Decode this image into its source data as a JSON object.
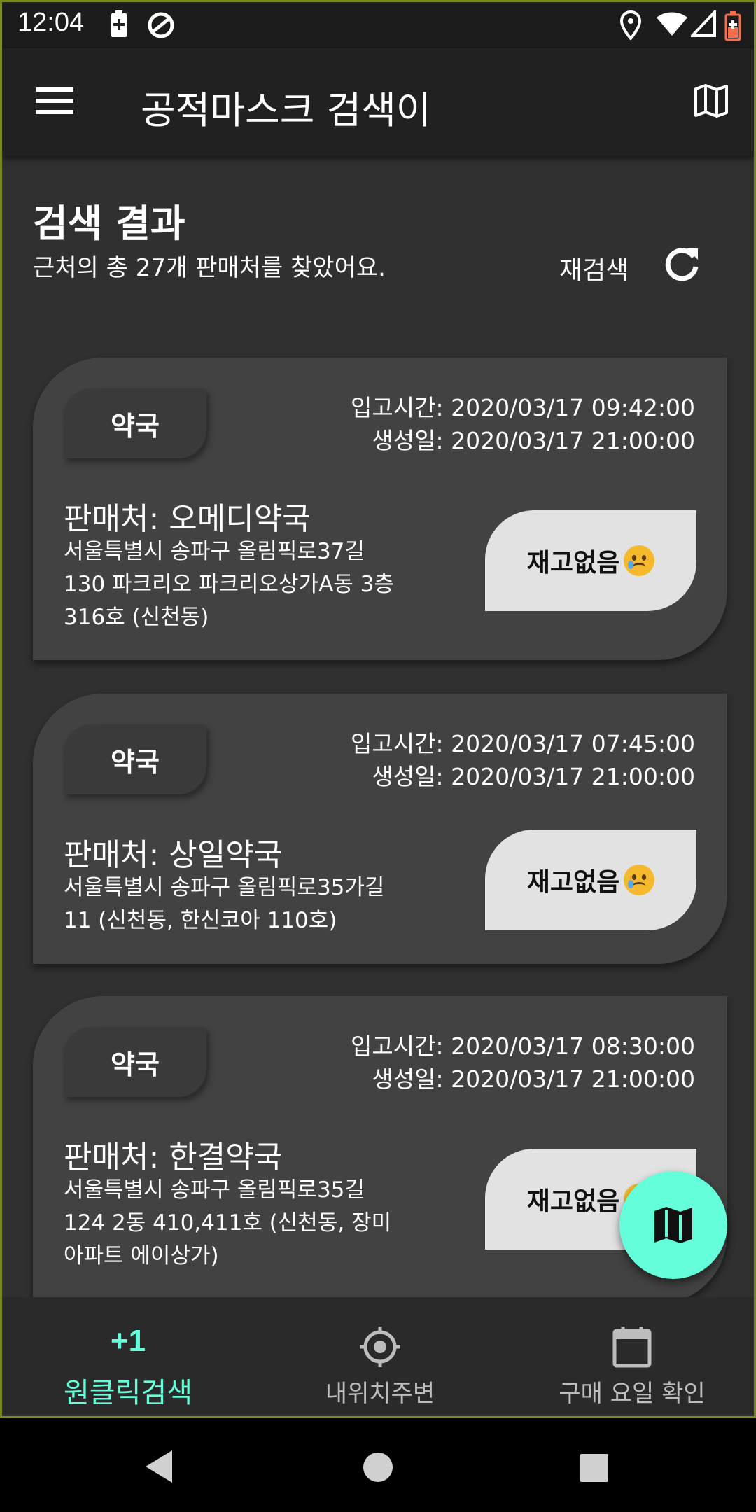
{
  "status_bar": {
    "time": "12:04"
  },
  "app_bar": {
    "title": "공적마스크 검색이"
  },
  "results": {
    "title": "검색 결과",
    "summary": "근처의 총 27개 판매처를 찾았어요.",
    "refresh_label": "재검색"
  },
  "stores": [
    {
      "type": "약국",
      "stock_time": "입고시간: 2020/03/17 09:42:00",
      "created": "생성일: 2020/03/17 21:00:00",
      "seller": "판매처: 오메디약국",
      "address": "서울특별시 송파구 올림픽로37길 130 파크리오 파크리오상가A동 3층 316호 (신천동)",
      "stock_status": "재고없음"
    },
    {
      "type": "약국",
      "stock_time": "입고시간: 2020/03/17 07:45:00",
      "created": "생성일: 2020/03/17 21:00:00",
      "seller": "판매처: 상일약국",
      "address": "서울특별시 송파구 올림픽로35가길 11 (신천동, 한신코아 110호)",
      "stock_status": "재고없음"
    },
    {
      "type": "약국",
      "stock_time": "입고시간: 2020/03/17 08:30:00",
      "created": "생성일: 2020/03/17 21:00:00",
      "seller": "판매처: 한결약국",
      "address": "서울특별시 송파구 올림픽로35길 124 2동 410,411호 (신천동, 장미아파트 에이상가)",
      "stock_status": "재고없음"
    }
  ],
  "bottom_nav": {
    "items": [
      {
        "badge": "+1",
        "label": "원클릭검색"
      },
      {
        "label": "내위치주변"
      },
      {
        "label": "구매 요일 확인"
      }
    ]
  },
  "colors": {
    "accent": "#64ffda",
    "card": "#424242",
    "background": "#303030"
  },
  "icons": [
    "menu-icon",
    "map-icon",
    "refresh-icon",
    "crosshair-icon",
    "calendar-icon",
    "crying-face-icon"
  ]
}
